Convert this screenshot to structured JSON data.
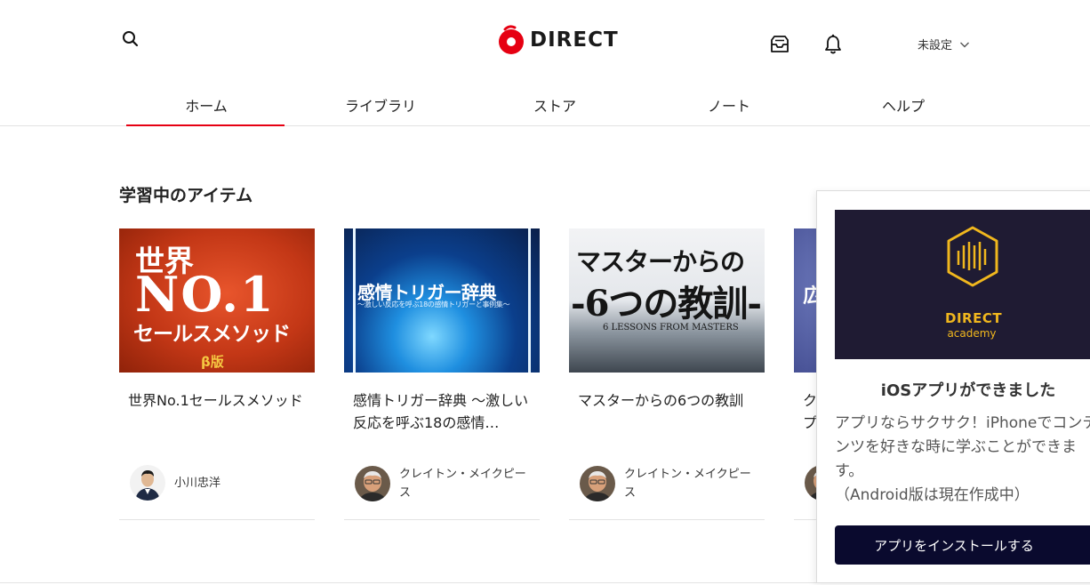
{
  "header": {
    "logo_text": "DIRECT",
    "account_label": "未設定",
    "icons": {
      "search": "search-icon",
      "inbox": "inbox-icon",
      "bell": "bell-icon",
      "chevron": "chevron-down-icon"
    }
  },
  "tabs": [
    {
      "label": "ホーム",
      "active": true
    },
    {
      "label": "ライブラリ",
      "active": false
    },
    {
      "label": "ストア",
      "active": false
    },
    {
      "label": "ノート",
      "active": false
    },
    {
      "label": "ヘルプ",
      "active": false
    }
  ],
  "section": {
    "title": "学習中のアイテム"
  },
  "cards": [
    {
      "title": "世界No.1セールスメソッド",
      "author": "小川忠洋",
      "thumb": {
        "line1": "世界",
        "line2": "NO.1",
        "line3": "セールスメソッド",
        "line4": "β版"
      }
    },
    {
      "title": "感情トリガー辞典 〜激しい反応を呼ぶ18の感情…",
      "author": "クレイトン・メイクピース",
      "thumb": {
        "line1": "感情トリガー辞典",
        "line2": "〜激しい反応を呼ぶ18の感情トリガーと事例集〜"
      }
    },
    {
      "title": "マスターからの6つの教訓",
      "author": "クレイトン・メイクピース",
      "thumb": {
        "line1": "マスターからの",
        "line2": "-6つの教訓-",
        "line3": "6 LESSONS FROM MASTERS"
      }
    },
    {
      "title": "ク プ",
      "thumb": {
        "line1": "広"
      }
    }
  ],
  "popup": {
    "brand_line1": "DIRECT",
    "brand_line2": "academy",
    "title": "iOSアプリができました",
    "body": "アプリならサクサク！iPhoneでコンテンツを好きな時に学ぶことができます。",
    "note": "（Android版は現在作成中）",
    "button_label": "アプリをインストールする"
  },
  "colors": {
    "accent": "#e60012",
    "button_bg": "#0a0a2e",
    "brand_gold": "#f0b71e",
    "banner_bg": "#1f1b33"
  }
}
